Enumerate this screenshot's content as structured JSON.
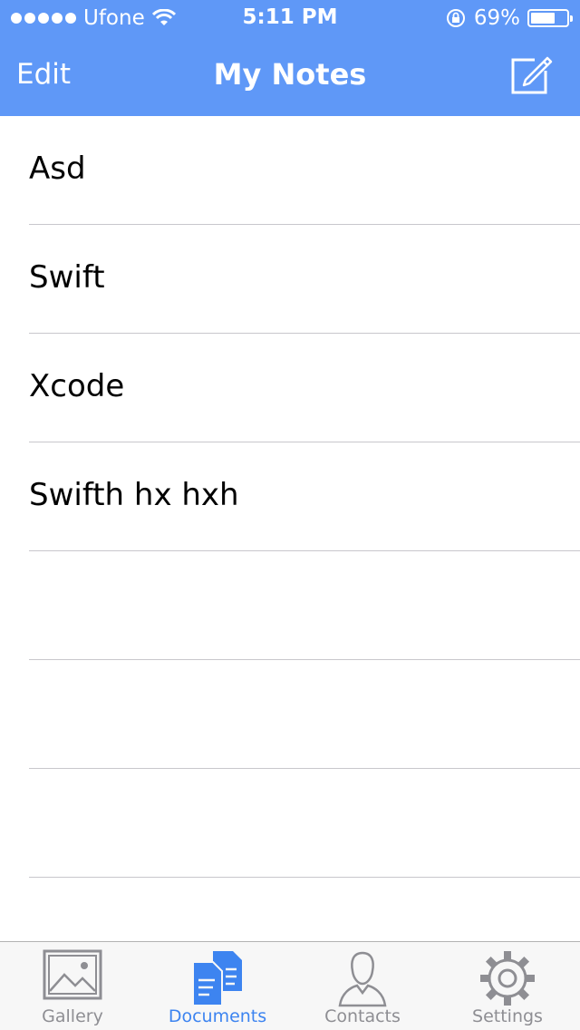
{
  "status_bar": {
    "carrier": "Ufone",
    "time": "5:11 PM",
    "battery_percent_text": "69%",
    "battery_level": 0.69
  },
  "nav": {
    "left_label": "Edit",
    "title": "My Notes",
    "right_icon": "compose-icon"
  },
  "notes": [
    {
      "title": "Asd"
    },
    {
      "title": "Swift"
    },
    {
      "title": "Xcode"
    },
    {
      "title": "Swifth hx hxh"
    },
    {
      "title": ""
    },
    {
      "title": ""
    },
    {
      "title": ""
    }
  ],
  "tabs": [
    {
      "label": "Gallery",
      "icon": "gallery-icon",
      "active": false
    },
    {
      "label": "Documents",
      "icon": "documents-icon",
      "active": true
    },
    {
      "label": "Contacts",
      "icon": "contacts-icon",
      "active": false
    },
    {
      "label": "Settings",
      "icon": "settings-icon",
      "active": false
    }
  ],
  "colors": {
    "nav_background": "#5f98f7",
    "tab_active": "#3d84f0",
    "tab_inactive": "#8e8e93",
    "separator": "#c8c7cc"
  }
}
